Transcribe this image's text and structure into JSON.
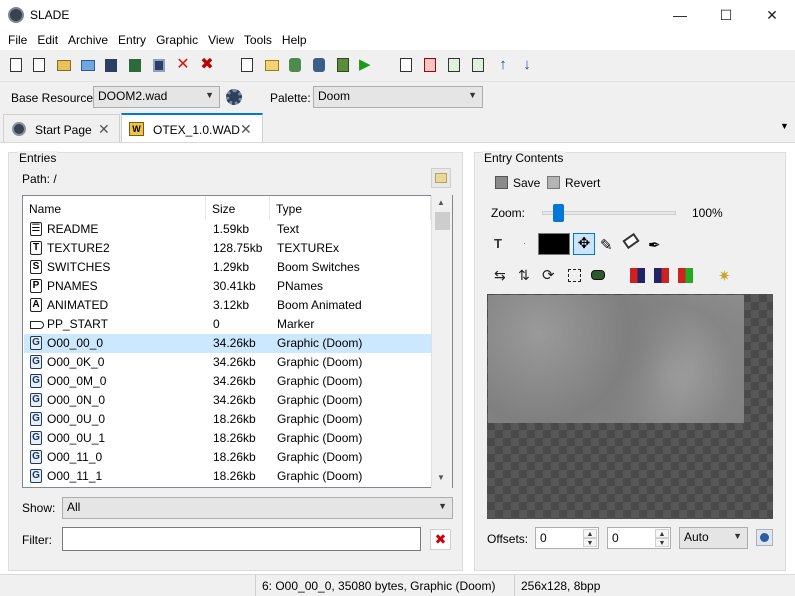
{
  "window": {
    "title": "SLADE",
    "minimize": "—",
    "maximize": "☐",
    "close": "✕"
  },
  "menu": [
    "File",
    "Edit",
    "Archive",
    "Entry",
    "Graphic",
    "View",
    "Tools",
    "Help"
  ],
  "resource": {
    "base_label": "Base Resource:",
    "base_value": "DOOM2.wad",
    "palette_label": "Palette:",
    "palette_value": "Doom"
  },
  "tabs": [
    {
      "label": "Start Page"
    },
    {
      "label": "OTEX_1.0.WAD"
    }
  ],
  "entries": {
    "group_label": "Entries",
    "path": "Path: /",
    "columns": [
      "Name",
      "Size",
      "Type"
    ],
    "rows": [
      {
        "icon": "text-icon",
        "glyph": "☰",
        "name": "README",
        "size": "1.59kb",
        "type": "Text"
      },
      {
        "icon": "texturex-icon",
        "glyph": "T",
        "name": "TEXTURE2",
        "size": "128.75kb",
        "type": "TEXTUREx"
      },
      {
        "icon": "switches-icon",
        "glyph": "S",
        "name": "SWITCHES",
        "size": "1.29kb",
        "type": "Boom Switches"
      },
      {
        "icon": "pnames-icon",
        "glyph": "P",
        "name": "PNAMES",
        "size": "30.41kb",
        "type": "PNames"
      },
      {
        "icon": "animated-icon",
        "glyph": "A",
        "name": "ANIMATED",
        "size": "3.12kb",
        "type": "Boom Animated"
      },
      {
        "icon": "marker-icon",
        "glyph": "",
        "name": "PP_START",
        "size": "0",
        "type": "Marker"
      },
      {
        "icon": "graphic-icon",
        "glyph": "G",
        "name": "O00_00_0",
        "size": "34.26kb",
        "type": "Graphic (Doom)"
      },
      {
        "icon": "graphic-icon",
        "glyph": "G",
        "name": "O00_0K_0",
        "size": "34.26kb",
        "type": "Graphic (Doom)"
      },
      {
        "icon": "graphic-icon",
        "glyph": "G",
        "name": "O00_0M_0",
        "size": "34.26kb",
        "type": "Graphic (Doom)"
      },
      {
        "icon": "graphic-icon",
        "glyph": "G",
        "name": "O00_0N_0",
        "size": "34.26kb",
        "type": "Graphic (Doom)"
      },
      {
        "icon": "graphic-icon",
        "glyph": "G",
        "name": "O00_0U_0",
        "size": "18.26kb",
        "type": "Graphic (Doom)"
      },
      {
        "icon": "graphic-icon",
        "glyph": "G",
        "name": "O00_0U_1",
        "size": "18.26kb",
        "type": "Graphic (Doom)"
      },
      {
        "icon": "graphic-icon",
        "glyph": "G",
        "name": "O00_11_0",
        "size": "18.26kb",
        "type": "Graphic (Doom)"
      },
      {
        "icon": "graphic-icon",
        "glyph": "G",
        "name": "O00_11_1",
        "size": "18.26kb",
        "type": "Graphic (Doom)"
      }
    ],
    "selected_index": 6,
    "show_label": "Show:",
    "show_value": "All",
    "filter_label": "Filter:",
    "filter_value": ""
  },
  "contents": {
    "group_label": "Entry Contents",
    "save_label": "Save",
    "revert_label": "Revert",
    "zoom_label": "Zoom:",
    "zoom_value": "100%",
    "zoom_fraction": 0.12,
    "offsets_label": "Offsets:",
    "offset_x": "0",
    "offset_y": "0",
    "offset_mode": "Auto"
  },
  "status": {
    "entry_info": "6: O00_00_0, 35080 bytes, Graphic (Doom)",
    "image_info": "256x128, 8bpp"
  }
}
